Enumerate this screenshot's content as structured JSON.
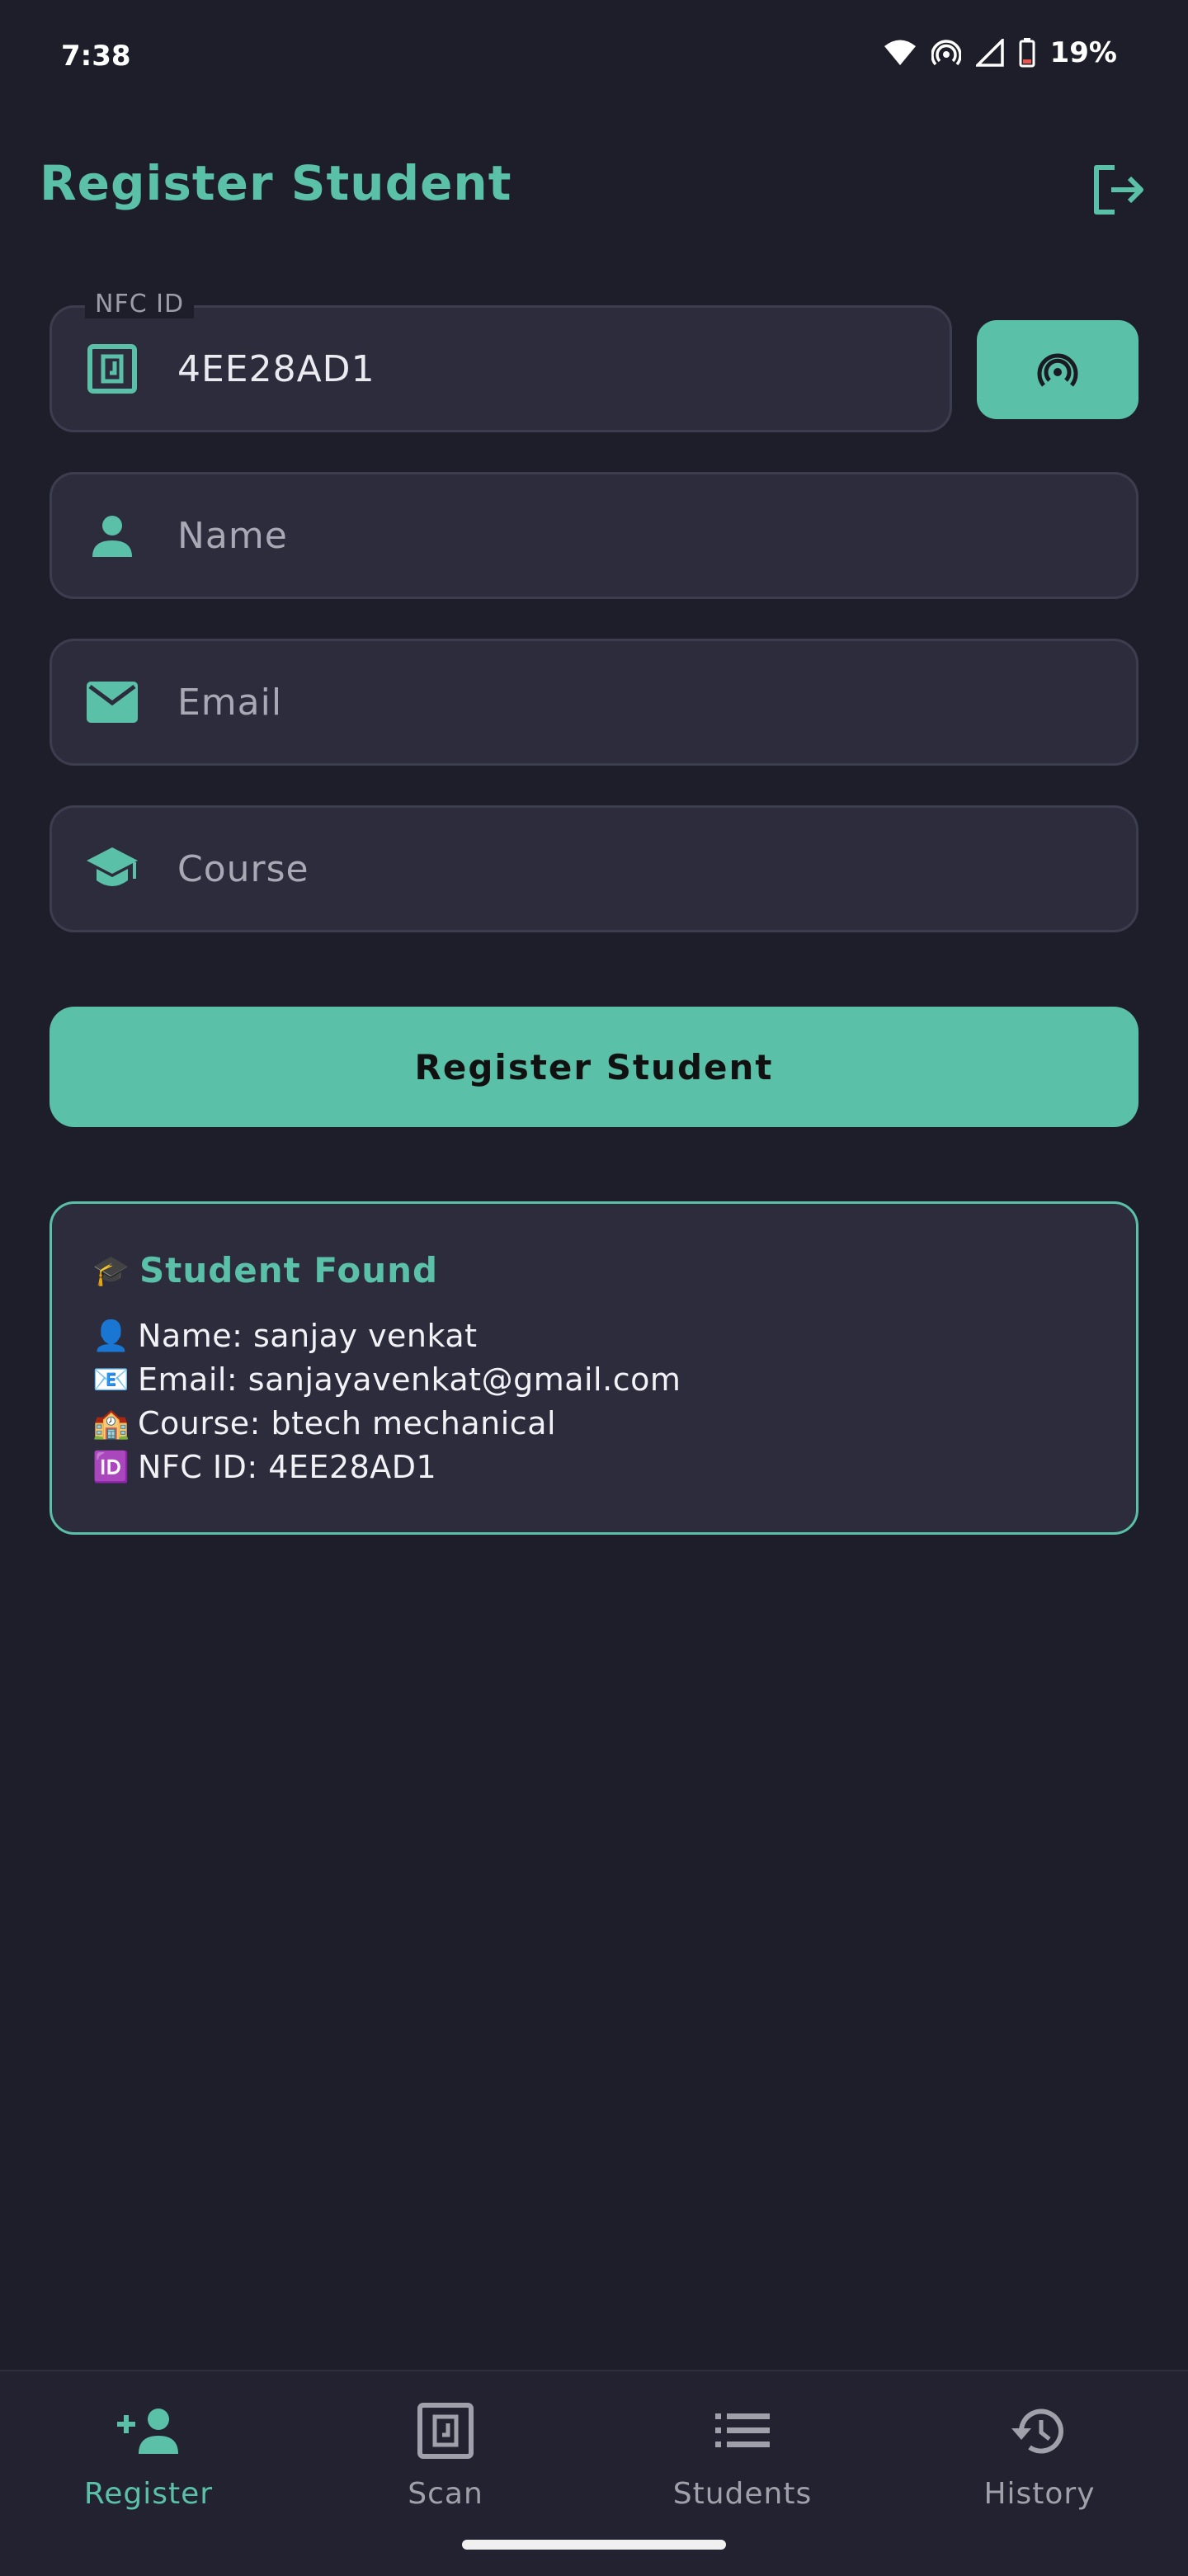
{
  "status_bar": {
    "time": "7:38",
    "battery": "19%"
  },
  "header": {
    "title": "Register Student"
  },
  "form": {
    "nfc": {
      "label": "NFC ID",
      "value": "4EE28AD1"
    },
    "name": {
      "placeholder": "Name"
    },
    "email": {
      "placeholder": "Email"
    },
    "course": {
      "placeholder": "Course"
    },
    "submit_label": "Register Student"
  },
  "student_card": {
    "title_emoji": "🎓",
    "title": "Student Found",
    "lines": [
      {
        "emoji": "👤",
        "text": "Name: sanjay venkat"
      },
      {
        "emoji": "📧",
        "text": "Email: sanjayavenkat@gmail.com"
      },
      {
        "emoji": "🏫",
        "text": "Course: btech mechanical"
      },
      {
        "emoji": "🆔",
        "text": "NFC ID: 4EE28AD1"
      }
    ]
  },
  "bottom_nav": {
    "items": [
      {
        "label": "Register",
        "icon": "add-person-icon",
        "active": true
      },
      {
        "label": "Scan",
        "icon": "nfc-icon",
        "active": false
      },
      {
        "label": "Students",
        "icon": "list-icon",
        "active": false
      },
      {
        "label": "History",
        "icon": "history-icon",
        "active": false
      }
    ]
  },
  "colors": {
    "accent": "#5ac0a8",
    "background": "#1e1e2a",
    "field": "#2c2c3c"
  }
}
